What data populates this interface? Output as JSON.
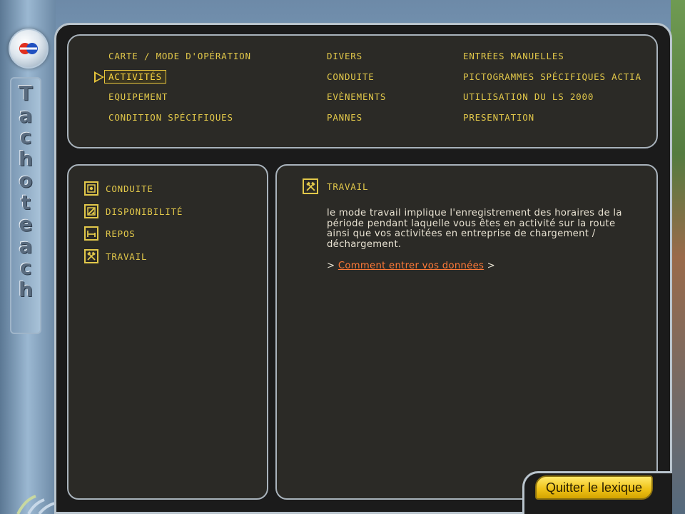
{
  "sidebar": {
    "vertical_title_letters": [
      "T",
      "a",
      "c",
      "h",
      "o",
      "t",
      "e",
      "a",
      "c",
      "h"
    ]
  },
  "menu": {
    "col1": [
      "carte / mode d'opération",
      "activités",
      "equipement",
      "condition spécifiques"
    ],
    "col2": [
      "divers",
      "conduite",
      "evènements",
      "pannes"
    ],
    "col3": [
      "entrées manuelles",
      "pictogrammes spécifiques actia",
      "utilisation du ls 2000",
      "presentation"
    ],
    "selected": "activités"
  },
  "activities": [
    {
      "label": "conduite",
      "icon": "steering-wheel-icon"
    },
    {
      "label": "disponibilité",
      "icon": "availability-icon"
    },
    {
      "label": "repos",
      "icon": "bed-icon"
    },
    {
      "label": "travail",
      "icon": "hammers-icon"
    }
  ],
  "detail": {
    "title": "travail",
    "icon": "hammers-icon",
    "paragraph": "le mode travail implique l'enregistrement des horaires de la période pendant laquelle vous êtes en activité sur la route ainsi que vos activitées en entreprise de chargement / déchargement.",
    "link_prefix": ">",
    "link_text": "Comment entrer vos données",
    "link_suffix": ">"
  },
  "footer": {
    "quit_label": "Quitter le lexique"
  },
  "colors": {
    "accent": "#e2c84a",
    "link": "#ff7a38",
    "panel": "#2b2a26"
  }
}
